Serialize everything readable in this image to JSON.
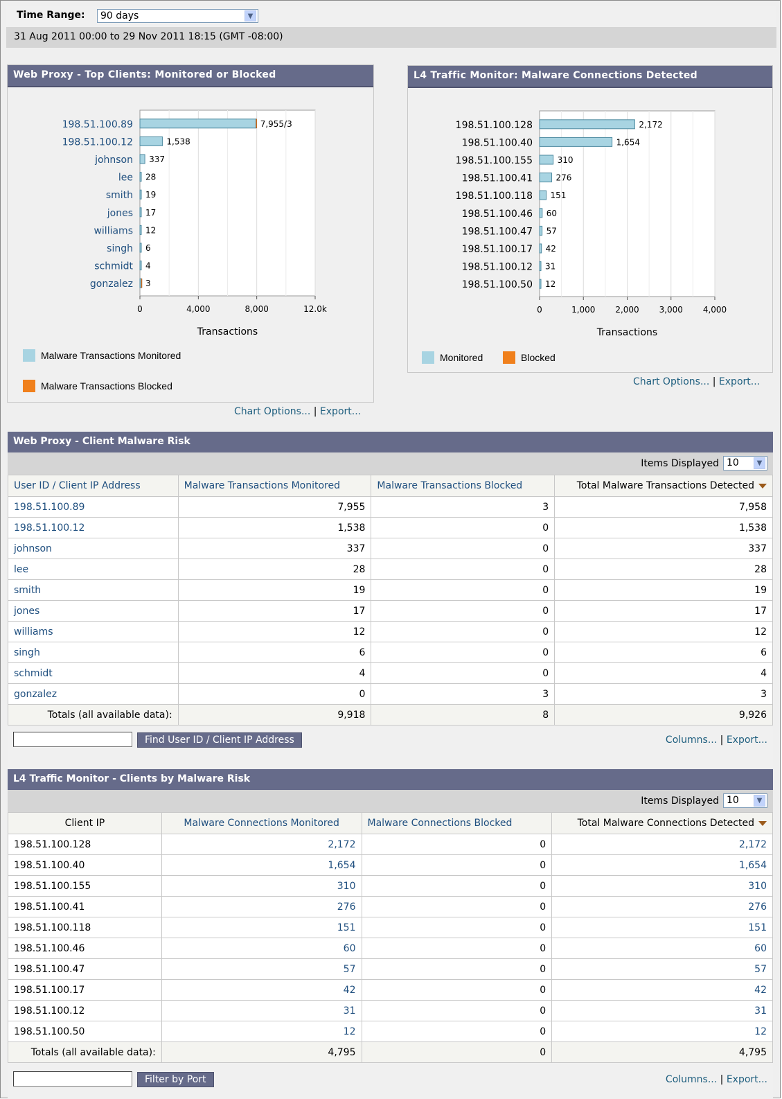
{
  "time_range": {
    "label": "Time Range:",
    "value": "90 days"
  },
  "date_range": "31 Aug 2011 00:00 to 29 Nov 2011 18:15 (GMT -08:00)",
  "colors": {
    "monitored": "#a8d4e2",
    "blocked": "#f0801c",
    "header": "#666b8a",
    "link": "#1f4f7f"
  },
  "web_chart": {
    "title": "Web Proxy - Top Clients: Monitored or Blocked",
    "links": {
      "options": "Chart Options...",
      "sep": "|",
      "export": "Export..."
    }
  },
  "l4_chart": {
    "title": "L4 Traffic Monitor: Malware Connections Detected",
    "links": {
      "options": "Chart Options...",
      "sep": "|",
      "export": "Export..."
    }
  },
  "chart_data": [
    {
      "type": "bar",
      "orientation": "horizontal",
      "title": "Web Proxy - Top Clients: Monitored or Blocked",
      "categories": [
        "198.51.100.89",
        "198.51.100.12",
        "johnson",
        "lee",
        "smith",
        "jones",
        "williams",
        "singh",
        "schmidt",
        "gonzalez"
      ],
      "category_links": true,
      "series": [
        {
          "name": "Malware Transactions Monitored",
          "values": [
            7955,
            1538,
            337,
            28,
            19,
            17,
            12,
            6,
            4,
            0
          ]
        },
        {
          "name": "Malware Transactions Blocked",
          "values": [
            3,
            0,
            0,
            0,
            0,
            0,
            0,
            0,
            0,
            3
          ]
        }
      ],
      "data_labels": [
        "7,955/3",
        "1,538",
        "337",
        "28",
        "19",
        "17",
        "12",
        "6",
        "4",
        "3"
      ],
      "xlabel": "Transactions",
      "xticks": [
        "0",
        "4,000",
        "8,000",
        "12.0k"
      ],
      "xtick_values": [
        0,
        4000,
        8000,
        12000
      ],
      "xlim": [
        0,
        12000
      ],
      "grid": true,
      "legend": "bottom"
    },
    {
      "type": "bar",
      "orientation": "horizontal",
      "title": "L4 Traffic Monitor: Malware Connections Detected",
      "categories": [
        "198.51.100.128",
        "198.51.100.40",
        "198.51.100.155",
        "198.51.100.41",
        "198.51.100.118",
        "198.51.100.46",
        "198.51.100.47",
        "198.51.100.17",
        "198.51.100.12",
        "198.51.100.50"
      ],
      "category_links": false,
      "series": [
        {
          "name": "Monitored",
          "values": [
            2172,
            1654,
            310,
            276,
            151,
            60,
            57,
            42,
            31,
            12
          ]
        },
        {
          "name": "Blocked",
          "values": [
            0,
            0,
            0,
            0,
            0,
            0,
            0,
            0,
            0,
            0
          ]
        }
      ],
      "data_labels": [
        "2,172",
        "1,654",
        "310",
        "276",
        "151",
        "60",
        "57",
        "42",
        "31",
        "12"
      ],
      "xlabel": "Transactions",
      "xticks": [
        "0",
        "1,000",
        "2,000",
        "3,000",
        "4,000"
      ],
      "xtick_values": [
        0,
        1000,
        2000,
        3000,
        4000
      ],
      "xlim": [
        0,
        4000
      ],
      "grid": true,
      "legend": "bottom"
    }
  ],
  "web_table": {
    "title": "Web Proxy - Client Malware Risk",
    "items_label": "Items Displayed",
    "items_value": "10",
    "headers": [
      "User ID / Client IP Address",
      "Malware Transactions Monitored",
      "Malware Transactions Blocked",
      "Total Malware Transactions Detected"
    ],
    "rows": [
      [
        "198.51.100.89",
        "7,955",
        "3",
        "7,958"
      ],
      [
        "198.51.100.12",
        "1,538",
        "0",
        "1,538"
      ],
      [
        "johnson",
        "337",
        "0",
        "337"
      ],
      [
        "lee",
        "28",
        "0",
        "28"
      ],
      [
        "smith",
        "19",
        "0",
        "19"
      ],
      [
        "jones",
        "17",
        "0",
        "17"
      ],
      [
        "williams",
        "12",
        "0",
        "12"
      ],
      [
        "singh",
        "6",
        "0",
        "6"
      ],
      [
        "schmidt",
        "4",
        "0",
        "4"
      ],
      [
        "gonzalez",
        "0",
        "3",
        "3"
      ]
    ],
    "totals": [
      "Totals (all available data):",
      "9,918",
      "8",
      "9,926"
    ],
    "find_button": "Find User ID / Client IP Address",
    "links": {
      "columns": "Columns...",
      "sep": "|",
      "export": "Export..."
    }
  },
  "l4_table": {
    "title": "L4 Traffic Monitor - Clients by Malware Risk",
    "items_label": "Items Displayed",
    "items_value": "10",
    "headers": [
      "Client IP",
      "Malware Connections Monitored",
      "Malware Connections Blocked",
      "Total Malware Connections Detected"
    ],
    "rows": [
      [
        "198.51.100.128",
        "2,172",
        "0",
        "2,172"
      ],
      [
        "198.51.100.40",
        "1,654",
        "0",
        "1,654"
      ],
      [
        "198.51.100.155",
        "310",
        "0",
        "310"
      ],
      [
        "198.51.100.41",
        "276",
        "0",
        "276"
      ],
      [
        "198.51.100.118",
        "151",
        "0",
        "151"
      ],
      [
        "198.51.100.46",
        "60",
        "0",
        "60"
      ],
      [
        "198.51.100.47",
        "57",
        "0",
        "57"
      ],
      [
        "198.51.100.17",
        "42",
        "0",
        "42"
      ],
      [
        "198.51.100.12",
        "31",
        "0",
        "31"
      ],
      [
        "198.51.100.50",
        "12",
        "0",
        "12"
      ]
    ],
    "totals": [
      "Totals (all available data):",
      "4,795",
      "0",
      "4,795"
    ],
    "filter_button": "Filter by Port",
    "links": {
      "columns": "Columns...",
      "sep": "|",
      "export": "Export..."
    }
  }
}
